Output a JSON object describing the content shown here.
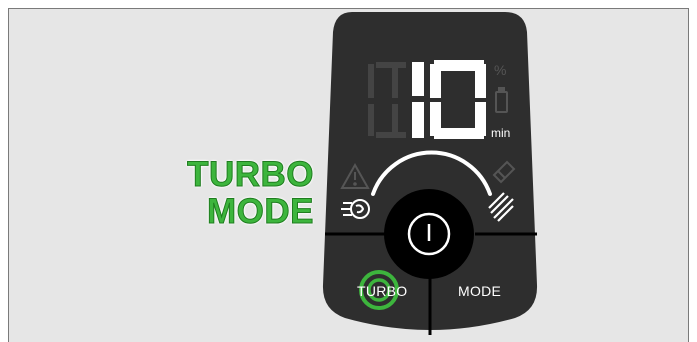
{
  "callout": {
    "line1": "TURBO",
    "line2": "MODE"
  },
  "display": {
    "value": "10",
    "unit": "min",
    "percent_symbol": "%"
  },
  "buttons": {
    "turbo_label": "TURBO",
    "mode_label": "MODE"
  },
  "icons": {
    "warning": "warning-icon",
    "battery": "battery-icon",
    "filter": "filter-icon",
    "brush": "brush-roll-icon",
    "turbo": "turbo-icon",
    "power": "power-icon"
  },
  "colors": {
    "panel": "#2e2e2e",
    "highlight": "#3db53d",
    "dim_segment": "#444444",
    "lit_segment": "#ffffff"
  }
}
